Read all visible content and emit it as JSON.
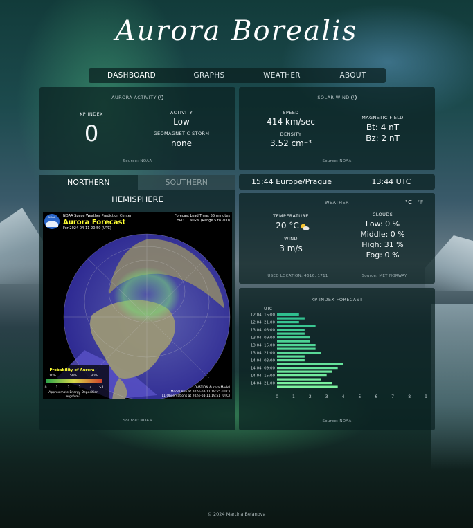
{
  "app": {
    "title": "Aurora Borealis"
  },
  "nav": {
    "items": [
      "DASHBOARD",
      "GRAPHS",
      "WEATHER",
      "ABOUT"
    ]
  },
  "aurora_activity": {
    "title": "AURORA ACTIVITY",
    "kp_label": "KP INDEX",
    "kp_value": "0",
    "activity_label": "ACTIVITY",
    "activity_value": "Low",
    "storm_label": "GEOMAGNETIC STORM",
    "storm_value": "none",
    "source": "Source: NOAA"
  },
  "solar_wind": {
    "title": "SOLAR WIND",
    "speed_label": "SPEED",
    "speed_value": "414 km/sec",
    "density_label": "DENSITY",
    "density_value": "3.52 cm⁻³",
    "magnetic_label": "MAGNETIC FIELD",
    "bt_value": "Bt: 4 nT",
    "bz_value": "Bz: 2 nT",
    "source": "Source: NOAA"
  },
  "hemisphere": {
    "tabs": [
      "NORTHERN",
      "SOUTHERN"
    ],
    "title": "HEMISPHERE",
    "source": "Source: NOAA",
    "map": {
      "header_left": "NOAA Space Weather Prediction Center",
      "map_title": "Aurora Forecast",
      "for_time": "For 2024-04-11 20:50 (UTC)",
      "lead_time": "Forecast Lead Time:  55 minutes",
      "hpi": "HPI:  11.9 GW (Range 5 to 200)",
      "prob_title": "Probability of Aurora",
      "prob_ticks": [
        "10%",
        "50%",
        "90%"
      ],
      "scale_ticks": [
        "0",
        "1",
        "2",
        "3",
        "4",
        ">4"
      ],
      "scale_caption1": "Approximate Energy Deposition",
      "scale_caption2": "ergs/cm2",
      "model_line1": "OVATION Aurora Model",
      "model_line2": "Model Run at 2024-04-11 19:55 (UTC)",
      "model_line3": "L1 Observations at 2024-04-11 19:51 (UTC)",
      "noaa_badge": "NOAA"
    }
  },
  "time": {
    "local": "15:44 Europe/Prague",
    "utc": "13:44 UTC"
  },
  "weather": {
    "title": "WEATHER",
    "unit_c": "°C",
    "unit_f": "°F",
    "temperature_label": "TEMPERATURE",
    "temperature_value": "20 °C",
    "weather_icon": "sun-cloud-icon",
    "wind_label": "WIND",
    "wind_value": "3 m/s",
    "clouds_label": "CLOUDS",
    "clouds_low": "Low: 0 %",
    "clouds_middle": "Middle: 0 %",
    "clouds_high": "High: 31 %",
    "clouds_fog": "Fog: 0 %",
    "location": "USED LOCATION: 4616, 1711",
    "source": "Source: MET NORWAY"
  },
  "kp_forecast": {
    "title": "KP INDEX FORECAST",
    "source": "Source: NOAA",
    "chart_data": {
      "type": "bar",
      "orientation": "horizontal",
      "title": "KP INDEX FORECAST",
      "ylabel": "UTC",
      "xlim": [
        0,
        9
      ],
      "x_ticks": [
        "0",
        "1",
        "2",
        "3",
        "4",
        "5",
        "6",
        "7",
        "8",
        "9"
      ],
      "categories": [
        "12.04. 15:00",
        "",
        "12.04. 21:00",
        "",
        "13.04. 03:00",
        "",
        "13.04. 09:00",
        "",
        "13.04. 15:00",
        "",
        "13.04. 21:00",
        "",
        "14.04. 03:00",
        "",
        "14.04. 09:00",
        "",
        "14.04. 15:00",
        "",
        "14.04. 21:00",
        ""
      ],
      "values": [
        1.33,
        1.67,
        1.33,
        2.33,
        1.67,
        1.67,
        2.0,
        2.0,
        2.33,
        2.33,
        2.67,
        1.67,
        1.67,
        4.0,
        3.67,
        3.33,
        3.0,
        2.67,
        3.33,
        3.67
      ],
      "grid": false,
      "color_start": "#2fbf8f",
      "color_end": "#7ef2a0"
    }
  },
  "footer": {
    "text": "© 2024 Martina Belanova"
  }
}
